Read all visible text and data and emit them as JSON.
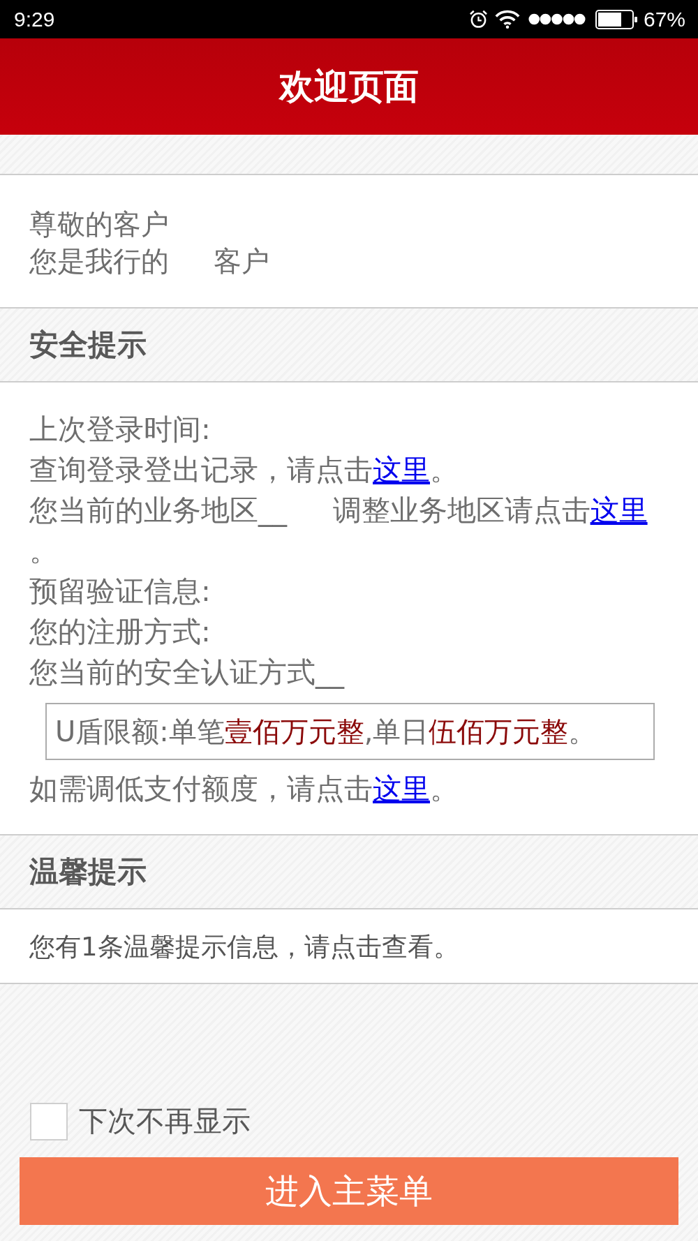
{
  "status_bar": {
    "time": "9:29",
    "battery_percent": "67%"
  },
  "title_bar": {
    "title": "欢迎页面"
  },
  "greeting": {
    "lines": [
      {
        "segments": [
          {
            "kind": "text",
            "text": "尊敬的客户"
          }
        ]
      },
      {
        "segments": [
          {
            "kind": "text",
            "text": "您是我行的"
          },
          {
            "kind": "blank"
          },
          {
            "kind": "text",
            "text": "客户"
          }
        ]
      }
    ]
  },
  "security": {
    "title": "安全提示",
    "items": [
      {
        "kind": "line",
        "segments": [
          {
            "kind": "text",
            "text": "上次登录时间:"
          }
        ]
      },
      {
        "kind": "line",
        "segments": [
          {
            "kind": "text",
            "text": "查询登录登出记录，请点击"
          },
          {
            "kind": "link",
            "text": "这里"
          },
          {
            "kind": "text",
            "text": "。"
          }
        ]
      },
      {
        "kind": "line",
        "segments": [
          {
            "kind": "text",
            "text": "您当前的业务地区__"
          },
          {
            "kind": "blank"
          },
          {
            "kind": "text",
            "text": "调整业务地区请点击"
          },
          {
            "kind": "link",
            "text": "这里"
          },
          {
            "kind": "text",
            "text": "。"
          }
        ]
      },
      {
        "kind": "line",
        "segments": [
          {
            "kind": "text",
            "text": "预留验证信息:"
          }
        ]
      },
      {
        "kind": "line",
        "segments": [
          {
            "kind": "text",
            "text": "您的注册方式:"
          }
        ]
      },
      {
        "kind": "line",
        "segments": [
          {
            "kind": "text",
            "text": "您当前的安全认证方式__"
          }
        ]
      },
      {
        "kind": "notice",
        "segments": [
          {
            "kind": "text",
            "text": "U盾限额:单笔"
          },
          {
            "kind": "amount",
            "text": "壹佰万元整"
          },
          {
            "kind": "text",
            "text": ",单日"
          },
          {
            "kind": "amount",
            "text": "伍佰万元整"
          },
          {
            "kind": "text",
            "text": "。"
          }
        ]
      },
      {
        "kind": "line",
        "segments": [
          {
            "kind": "text",
            "text": "如需调低支付额度，请点击"
          },
          {
            "kind": "link",
            "text": "这里"
          },
          {
            "kind": "text",
            "text": "。"
          }
        ]
      }
    ]
  },
  "tips": {
    "title": "温馨提示",
    "message": "您有1条温馨提示信息，请点击查看。"
  },
  "dont_show_again": {
    "label": "下次不再显示",
    "checked": false
  },
  "enter_button": {
    "label": "进入主菜单"
  }
}
